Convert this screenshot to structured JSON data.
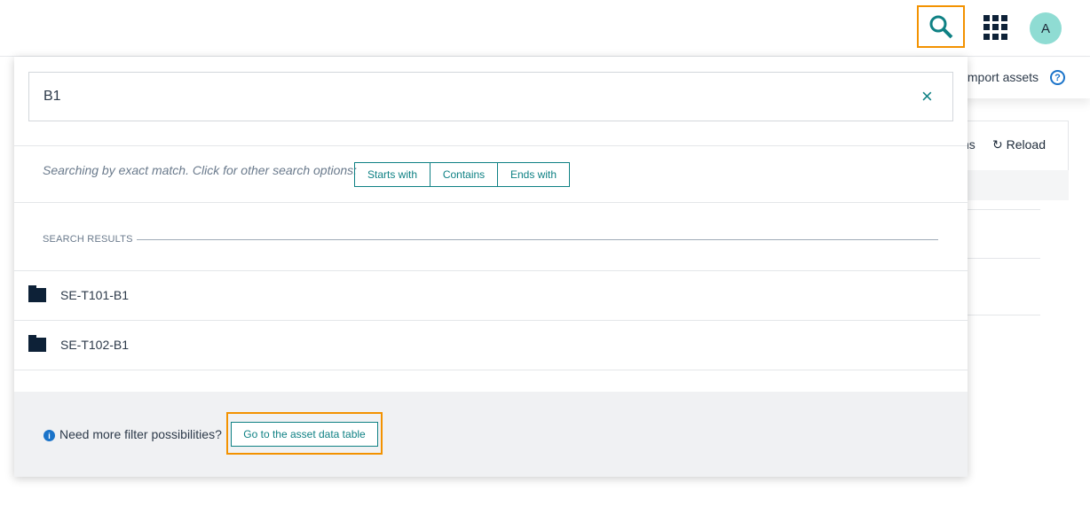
{
  "header": {
    "avatar_initial": "A",
    "import_label": "Import assets",
    "help_icon": "?",
    "options_label": "ns",
    "reload_label": "Reload"
  },
  "search": {
    "value": "B1",
    "clear_icon": "×",
    "hint": "Searching by exact match. Click for other search options:",
    "options": [
      "Starts with",
      "Contains",
      "Ends with"
    ],
    "results_heading": "SEARCH RESULTS",
    "results": [
      {
        "label": "SE-T101-B1",
        "icon": "folder-icon"
      },
      {
        "label": "SE-T102-B1",
        "icon": "folder-icon"
      }
    ]
  },
  "footer": {
    "info_icon": "i",
    "text": "Need more filter possibilities?",
    "button": "Go to the asset data table"
  },
  "colors": {
    "accent": "#0f8184",
    "highlight": "#f39200",
    "icon_dark": "#0d2137",
    "info": "#1a73c9"
  }
}
